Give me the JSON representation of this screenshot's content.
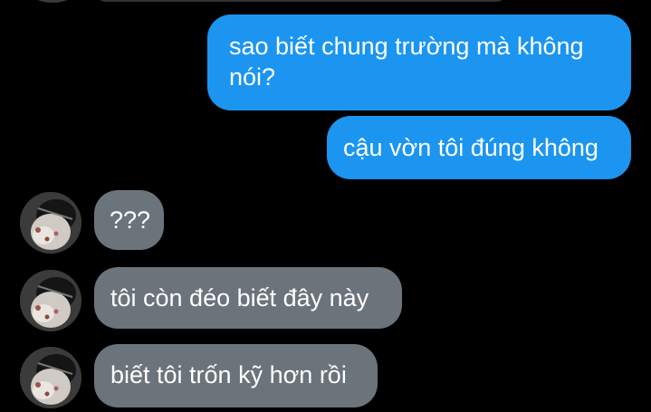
{
  "conversation": {
    "messages": [
      {
        "direction": "sent",
        "lines": [
          "sao biết chung trường mà không",
          "nói?"
        ]
      },
      {
        "direction": "sent",
        "lines": [
          "cậu vờn tôi đúng không"
        ]
      },
      {
        "direction": "received",
        "lines": [
          "???"
        ]
      },
      {
        "direction": "received",
        "lines": [
          "tôi còn đéo biết đây này"
        ]
      },
      {
        "direction": "received",
        "lines": [
          "biết tôi trốn kỹ hơn rồi"
        ]
      }
    ]
  },
  "colors": {
    "background": "#000000",
    "sent_bubble": "#1b95f0",
    "received_bubble": "#6b737b",
    "text": "#ffffff"
  }
}
